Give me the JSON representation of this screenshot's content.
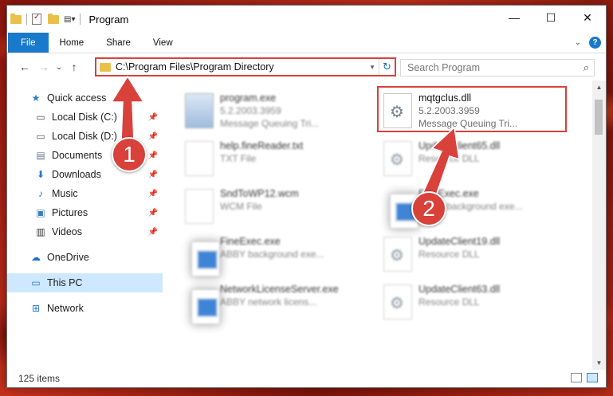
{
  "window": {
    "title": "Program",
    "controls": {
      "minimize": "—",
      "maximize": "☐",
      "close": "✕"
    }
  },
  "ribbon": {
    "tabs": [
      "File",
      "Home",
      "Share",
      "View"
    ],
    "help": "?"
  },
  "navbar": {
    "address": "C:\\Program Files\\Program Directory",
    "search_placeholder": "Search Program"
  },
  "sidebar": {
    "items": [
      {
        "label": "Quick access",
        "icon": "star-icon",
        "pinned": false
      },
      {
        "label": "Local Disk (C:)",
        "icon": "drive-icon",
        "pinned": true
      },
      {
        "label": "Local Disk (D:)",
        "icon": "drive-icon",
        "pinned": true
      },
      {
        "label": "Documents",
        "icon": "documents-icon",
        "pinned": true
      },
      {
        "label": "Downloads",
        "icon": "download-icon",
        "pinned": true
      },
      {
        "label": "Music",
        "icon": "music-icon",
        "pinned": true
      },
      {
        "label": "Pictures",
        "icon": "pictures-icon",
        "pinned": true
      },
      {
        "label": "Videos",
        "icon": "videos-icon",
        "pinned": true
      },
      {
        "label": "OneDrive",
        "icon": "cloud-icon",
        "pinned": false
      },
      {
        "label": "This PC",
        "icon": "computer-icon",
        "pinned": false,
        "selected": true
      },
      {
        "label": "Network",
        "icon": "network-icon",
        "pinned": false
      }
    ]
  },
  "files": [
    {
      "name": "program.exe",
      "line2": "5.2.2003.3959",
      "line3": "Message Queuing Tri...",
      "icon": "exe-icon"
    },
    {
      "name": "mqtgclus.dll",
      "line2": "5.2.2003.3959",
      "line3": "Message Queuing Tri...",
      "icon": "dll-gear-icon"
    },
    {
      "name": "help.fineReader.txt",
      "line2": "TXT File",
      "icon": "text-file-icon"
    },
    {
      "name": "UpdateClient65.dll",
      "line2": "Resource DLL",
      "icon": "dll-gear-icon"
    },
    {
      "name": "SndToWP12.wcm",
      "line2": "WCM File",
      "icon": "file-icon"
    },
    {
      "name": "FineExec.exe",
      "line2": "ABBY background exe...",
      "icon": "app-window-icon"
    },
    {
      "name": "FineExec.exe",
      "line2": "ABBY background exe...",
      "icon": "app-window-icon"
    },
    {
      "name": "UpdateClient19.dll",
      "line2": "Resource DLL",
      "icon": "dll-gear-icon"
    },
    {
      "name": "NetworkLicenseServer.exe",
      "line2": "ABBY network licens...",
      "icon": "app-window-icon"
    },
    {
      "name": "UpdateClient63.dll",
      "line2": "Resource DLL",
      "icon": "dll-gear-icon"
    }
  ],
  "status": {
    "count": "125 items"
  },
  "annotations": {
    "step1": "1",
    "step2": "2",
    "accent": "#d9413b"
  }
}
